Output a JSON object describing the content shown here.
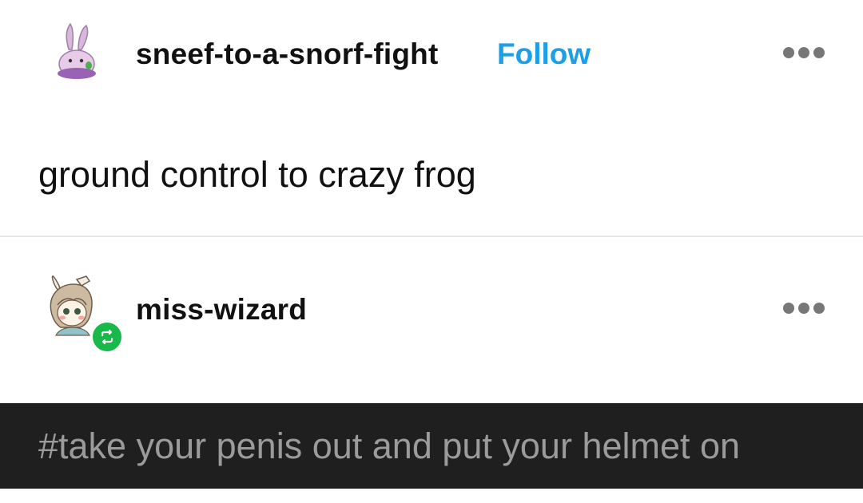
{
  "post": {
    "author": "sneef-to-a-snorf-fight",
    "follow_label": "Follow",
    "avatar_icon": "goomy-avatar-icon",
    "more_icon": "more-options-icon",
    "body": "ground control to crazy frog"
  },
  "reblog": {
    "author": "miss-wizard",
    "avatar_icon": "bunny-girl-avatar-icon",
    "badge_icon": "reblog-icon",
    "more_icon": "more-options-icon",
    "tag": "#take your penis out and put your helmet on"
  },
  "colors": {
    "follow": "#1d9fe6",
    "reblog_badge": "#18b84a",
    "tag_bar_bg": "#1f1f1f",
    "tag_text": "#9b9b9b"
  }
}
